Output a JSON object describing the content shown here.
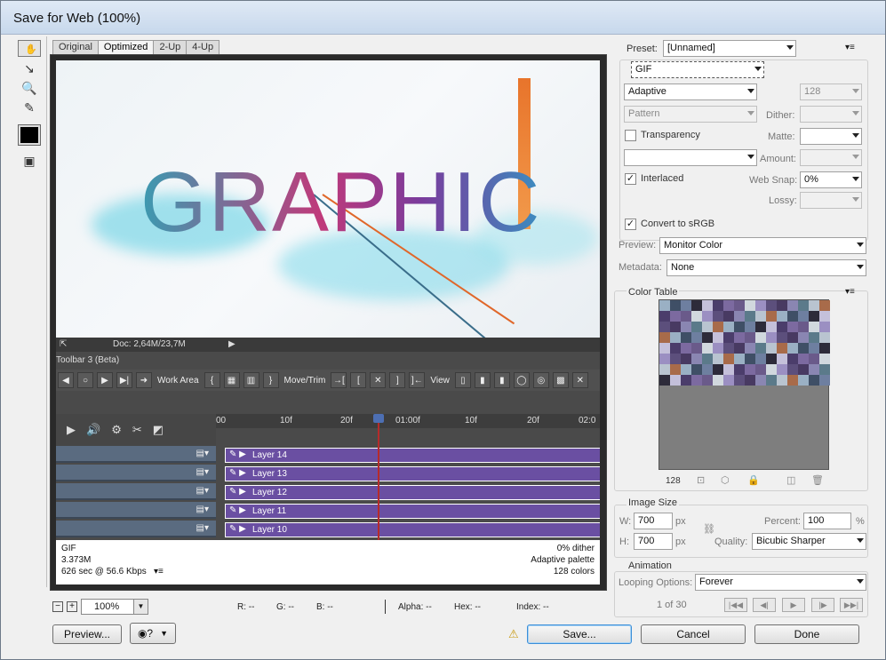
{
  "window": {
    "title": "Save for Web (100%)"
  },
  "tabs": [
    "Original",
    "Optimized",
    "2-Up",
    "4-Up"
  ],
  "artwork": {
    "text": "GRAPHIC"
  },
  "ps_bar": {
    "doc": "Doc: 2,64M/23,7M"
  },
  "timeline": {
    "title": "Toolbar 3 (Beta)",
    "work_area": "Work Area",
    "move_trim": "Move/Trim",
    "view": "View",
    "ruler": [
      "00",
      "10f",
      "20f",
      "01:00f",
      "10f",
      "20f",
      "02:0"
    ],
    "layers": [
      "Layer 14",
      "Layer 13",
      "Layer 12",
      "Layer 11",
      "Layer 10"
    ]
  },
  "info": {
    "format": "GIF",
    "size": "3.373M",
    "time": "626 sec @ 56.6 Kbps",
    "dither": "0% dither",
    "palette": "Adaptive palette",
    "colors": "128 colors"
  },
  "zoom": {
    "value": "100%"
  },
  "status": {
    "r": "R: --",
    "g": "G: --",
    "b": "B: --",
    "alpha": "Alpha: --",
    "hex": "Hex: --",
    "index": "Index: --"
  },
  "buttons": {
    "preview": "Preview...",
    "save": "Save...",
    "cancel": "Cancel",
    "done": "Done"
  },
  "settings": {
    "preset_label": "Preset:",
    "preset": "[Unnamed]",
    "format": "GIF",
    "reduction": "Adaptive",
    "colors": "128",
    "dither_algo": "Pattern",
    "dither_label": "Dither:",
    "transparency": "Transparency",
    "matte_label": "Matte:",
    "amount_label": "Amount:",
    "interlaced": "Interlaced",
    "websnap_label": "Web Snap:",
    "websnap": "0%",
    "lossy_label": "Lossy:",
    "convert": "Convert to sRGB",
    "preview_label": "Preview:",
    "preview": "Monitor Color",
    "metadata_label": "Metadata:",
    "metadata": "None"
  },
  "color_table": {
    "title": "Color Table",
    "count": "128"
  },
  "image_size": {
    "title": "Image Size",
    "w_label": "W:",
    "w": "700",
    "h_label": "H:",
    "h": "700",
    "px": "px",
    "percent_label": "Percent:",
    "percent": "100",
    "pct": "%",
    "quality_label": "Quality:",
    "quality": "Bicubic Sharper"
  },
  "animation": {
    "title": "Animation",
    "looping_label": "Looping Options:",
    "looping": "Forever",
    "frame": "1 of 30"
  },
  "colors": {
    "layer_bar": "#6a4fa2",
    "accent": "#3b8ed8",
    "playhead": "#b52b2b"
  }
}
